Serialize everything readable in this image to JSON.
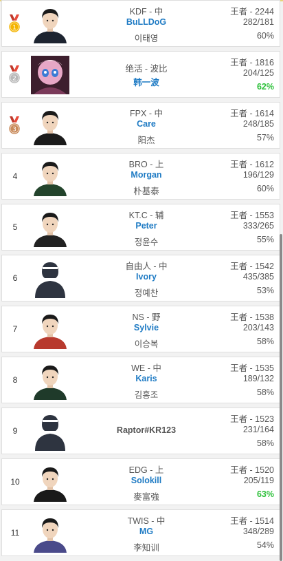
{
  "colors": {
    "link_blue": "#1f7bc4",
    "high_winrate_green": "#2fc13c",
    "text_gray": "#555555"
  },
  "rows": [
    {
      "rank": "1",
      "medal": "gold",
      "team_role": "KDF - 中",
      "name": "BuLLDoG",
      "real_name": "이태영",
      "tier": "王者 - 2244",
      "wl": "282/181",
      "winrate": "60%",
      "good": false,
      "avatar": "player-photo"
    },
    {
      "rank": "2",
      "medal": "silver",
      "team_role": "绝活 - 波比",
      "name": "韩一波",
      "real_name": "",
      "tier": "王者 - 1816",
      "wl": "204/125",
      "winrate": "62%",
      "good": true,
      "avatar": "champion-art"
    },
    {
      "rank": "3",
      "medal": "bronze",
      "team_role": "FPX - 中",
      "name": "Care",
      "real_name": "阳杰",
      "tier": "王者 - 1614",
      "wl": "248/185",
      "winrate": "57%",
      "good": false,
      "avatar": "player-photo"
    },
    {
      "rank": "4",
      "medal": "",
      "team_role": "BRO - 上",
      "name": "Morgan",
      "real_name": "朴基泰",
      "tier": "王者 - 1612",
      "wl": "196/129",
      "winrate": "60%",
      "good": false,
      "avatar": "player-photo"
    },
    {
      "rank": "5",
      "medal": "",
      "team_role": "KT.C - 辅",
      "name": "Peter",
      "real_name": "정윤수",
      "tier": "王者 - 1553",
      "wl": "333/265",
      "winrate": "55%",
      "good": false,
      "avatar": "player-photo"
    },
    {
      "rank": "6",
      "medal": "",
      "team_role": "自由人 - 中",
      "name": "Ivory",
      "real_name": "정예찬",
      "tier": "王者 - 1542",
      "wl": "435/385",
      "winrate": "53%",
      "good": false,
      "avatar": "default-silhouette"
    },
    {
      "rank": "7",
      "medal": "",
      "team_role": "NS - 野",
      "name": "Sylvie",
      "real_name": "이승복",
      "tier": "王者 - 1538",
      "wl": "203/143",
      "winrate": "58%",
      "good": false,
      "avatar": "player-photo"
    },
    {
      "rank": "8",
      "medal": "",
      "team_role": "WE - 中",
      "name": "Karis",
      "real_name": "김홍조",
      "tier": "王者 - 1535",
      "wl": "189/132",
      "winrate": "58%",
      "good": false,
      "avatar": "player-photo"
    },
    {
      "rank": "9",
      "medal": "",
      "team_role": "",
      "name": "Raptor#KR123",
      "real_name": "",
      "tier": "王者 - 1523",
      "wl": "231/164",
      "winrate": "58%",
      "good": false,
      "avatar": "default-silhouette",
      "plain": true
    },
    {
      "rank": "10",
      "medal": "",
      "team_role": "EDG - 上",
      "name": "Solokill",
      "real_name": "麥富強",
      "tier": "王者 - 1520",
      "wl": "205/119",
      "winrate": "63%",
      "good": true,
      "avatar": "player-photo"
    },
    {
      "rank": "11",
      "medal": "",
      "team_role": "TWIS - 中",
      "name": "MG",
      "real_name": "李知训",
      "tier": "王者 - 1514",
      "wl": "348/289",
      "winrate": "54%",
      "good": false,
      "avatar": "player-photo"
    }
  ]
}
